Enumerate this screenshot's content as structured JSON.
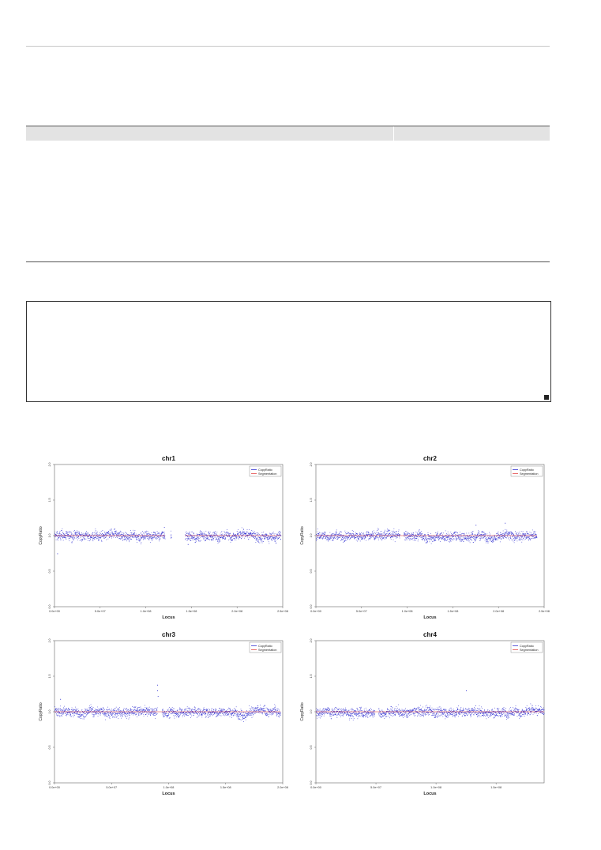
{
  "page": {
    "textbox_value": ""
  },
  "chart_data": [
    {
      "type": "scatter",
      "title": "chr1",
      "xlabel": "Locus",
      "ylabel": "CopyRatio",
      "x_ticks": [
        "0.0e+00",
        "5.0e+07",
        "1.0e+08",
        "1.5e+08",
        "2.0e+08",
        "2.5e+08"
      ],
      "x_max": 250000000.0,
      "y_ticks": [
        "0.0",
        "0.5",
        "1.0",
        "1.5",
        "2.0"
      ],
      "ylim": [
        0,
        2
      ],
      "legend": [
        "CopyRatio",
        "Segmentation"
      ],
      "legend_position": "top-right",
      "series": [
        {
          "name": "CopyRatio",
          "color": "#1a1acc",
          "ranges": [
            [
              0,
              121000000.0
            ],
            [
              127000000.0,
              128000000.0
            ],
            [
              143000000.0,
              248000000.0
            ]
          ],
          "baseline": 1.0
        },
        {
          "name": "Segmentation",
          "color": "#e03030",
          "segments": [
            [
              0,
              121000000.0,
              1.0
            ],
            [
              143000000.0,
              248000000.0,
              1.0
            ]
          ]
        }
      ],
      "outliers": [
        [
          3000000.0,
          0.75
        ],
        [
          120000000.0,
          1.12
        ],
        [
          146000000.0,
          0.88
        ]
      ]
    },
    {
      "type": "scatter",
      "title": "chr2",
      "xlabel": "Locus",
      "ylabel": "CopyRatio",
      "x_ticks": [
        "0.0e+00",
        "5.0e+07",
        "1.0e+08",
        "1.5e+08",
        "2.0e+08",
        "2.5e+08"
      ],
      "x_max": 250000000.0,
      "y_ticks": [
        "0.0",
        "0.5",
        "1.0",
        "1.5",
        "2.0"
      ],
      "ylim": [
        0,
        2
      ],
      "legend": [
        "CopyRatio",
        "Segmentation"
      ],
      "legend_position": "top-right",
      "series": [
        {
          "name": "CopyRatio",
          "color": "#1a1acc",
          "ranges": [
            [
              0,
              92000000.0
            ],
            [
              96000000.0,
              242000000.0
            ]
          ],
          "baseline": 1.0
        },
        {
          "name": "Segmentation",
          "color": "#e03030",
          "segments": [
            [
              0,
              242000000.0,
              1.0
            ]
          ]
        }
      ],
      "outliers": [
        [
          207000000.0,
          1.18
        ],
        [
          175000000.0,
          1.15
        ]
      ]
    },
    {
      "type": "scatter",
      "title": "chr3",
      "xlabel": "Locus",
      "ylabel": "CopyRatio",
      "x_ticks": [
        "0.0e+00",
        "5.0e+07",
        "1.0e+08",
        "1.5e+08",
        "2.0e+08"
      ],
      "x_max": 200000000.0,
      "y_ticks": [
        "0.0",
        "0.5",
        "1.0",
        "1.5",
        "2.0"
      ],
      "ylim": [
        0,
        2
      ],
      "legend": [
        "CopyRatio",
        "Segmentation"
      ],
      "legend_position": "top-right",
      "series": [
        {
          "name": "CopyRatio",
          "color": "#1a1acc",
          "ranges": [
            [
              0,
              90000000.0
            ],
            [
              94000000.0,
              198000000.0
            ]
          ],
          "baseline": 1.0
        },
        {
          "name": "Segmentation",
          "color": "#e03030",
          "segments": [
            [
              0,
              198000000.0,
              1.0
            ]
          ]
        }
      ],
      "outliers": [
        [
          90000000.0,
          1.38
        ],
        [
          90000000.0,
          1.3
        ],
        [
          90500000.0,
          1.22
        ],
        [
          5000000.0,
          1.18
        ]
      ]
    },
    {
      "type": "scatter",
      "title": "chr4",
      "xlabel": "Locus",
      "ylabel": "CopyRatio",
      "x_ticks": [
        "0.0e+00",
        "5.0e+07",
        "1.0e+08",
        "1.5e+08"
      ],
      "x_max": 190000000.0,
      "y_ticks": [
        "0.0",
        "0.5",
        "1.0",
        "1.5",
        "2.0"
      ],
      "ylim": [
        0,
        2
      ],
      "legend": [
        "CopyRatio",
        "Segmentation"
      ],
      "legend_position": "top-right",
      "series": [
        {
          "name": "CopyRatio",
          "color": "#1a1acc",
          "ranges": [
            [
              0,
              49000000.0
            ],
            [
              52000000.0,
              190000000.0
            ]
          ],
          "baseline": 1.0
        },
        {
          "name": "Segmentation",
          "color": "#e03030",
          "segments": [
            [
              0,
              190000000.0,
              1.0
            ]
          ]
        }
      ],
      "outliers": [
        [
          125000000.0,
          1.3
        ]
      ]
    }
  ]
}
